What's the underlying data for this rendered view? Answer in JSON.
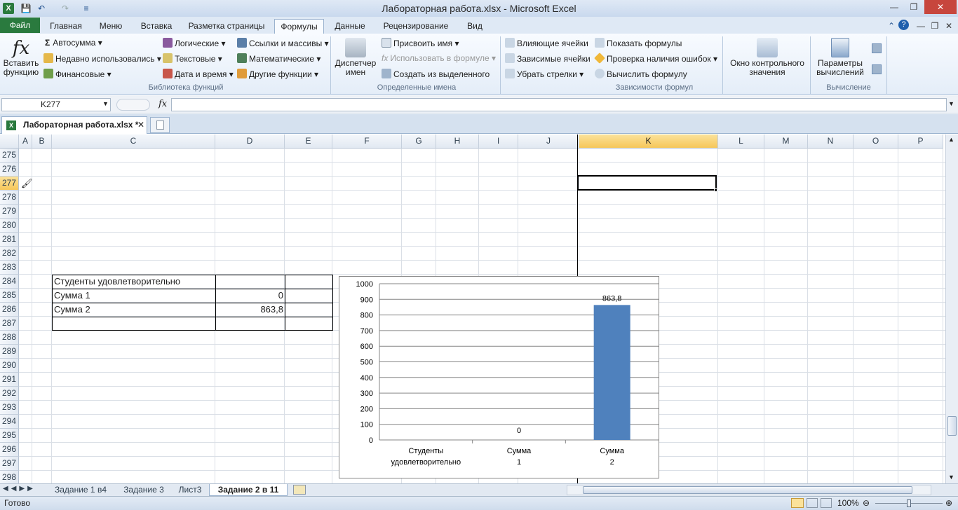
{
  "window": {
    "title": "Лабораторная работа.xlsx  -  Microsoft Excel"
  },
  "tabs": [
    "Файл",
    "Главная",
    "Меню",
    "Вставка",
    "Разметка страницы",
    "Формулы",
    "Данные",
    "Рецензирование",
    "Вид"
  ],
  "ribbon": {
    "insert_function": "Вставить функцию",
    "lib": {
      "autosum": "Автосумма",
      "recent": "Недавно использовались",
      "financial": "Финансовые",
      "logical": "Логические",
      "text": "Текстовые",
      "datetime": "Дата и время",
      "lookup": "Ссылки и массивы",
      "math": "Математические",
      "other": "Другие функции",
      "label": "Библиотека функций"
    },
    "names": {
      "manager": "Диспетчер имен",
      "define": "Присвоить имя",
      "use": "Использовать в формуле",
      "create": "Создать из выделенного",
      "label": "Определенные имена"
    },
    "audit": {
      "precedents": "Влияющие ячейки",
      "dependents": "Зависимые ячейки",
      "remove": "Убрать стрелки",
      "show": "Показать формулы",
      "check": "Проверка наличия ошибок",
      "evaluate": "Вычислить формулу",
      "watch": "Окно контрольного значения",
      "label": "Зависимости формул"
    },
    "calc": {
      "options": "Параметры вычислений",
      "label": "Вычисление"
    }
  },
  "formula_bar": {
    "name_box": "K277",
    "fx": "fx",
    "value": ""
  },
  "workbook_tab": "Лабораторная работа.xlsx *",
  "columns": [
    "A",
    "B",
    "C",
    "D",
    "E",
    "F",
    "G",
    "H",
    "I",
    "J",
    "K",
    "L",
    "M",
    "N",
    "O",
    "P"
  ],
  "rows": [
    "275",
    "276",
    "277",
    "278",
    "279",
    "280",
    "281",
    "282",
    "283",
    "284",
    "285",
    "286",
    "287",
    "288",
    "289",
    "290",
    "291",
    "292",
    "293",
    "294",
    "295",
    "296",
    "297",
    "298"
  ],
  "cells": {
    "c284": "Студенты удовлетворительно",
    "c285": "Сумма 1",
    "d285": "0",
    "c286": "Сумма 2",
    "d286": "863,8"
  },
  "chart_data": {
    "type": "bar",
    "categories": [
      "Студенты удовлетворительно",
      "Сумма 1",
      "Сумма 2"
    ],
    "values": [
      null,
      0,
      863.8
    ],
    "data_labels": [
      "",
      "0",
      "863,8"
    ],
    "y_ticks": [
      "0",
      "100",
      "200",
      "300",
      "400",
      "500",
      "600",
      "700",
      "800",
      "900",
      "1000"
    ],
    "ylim": [
      0,
      1000
    ],
    "grid": true,
    "bar_color": "#4f81bd"
  },
  "sheets": [
    "Задание 1 в4",
    "Задание 3",
    "Лист3",
    "Задание 2 в 11"
  ],
  "status": {
    "ready": "Готово",
    "zoom": "100%"
  }
}
